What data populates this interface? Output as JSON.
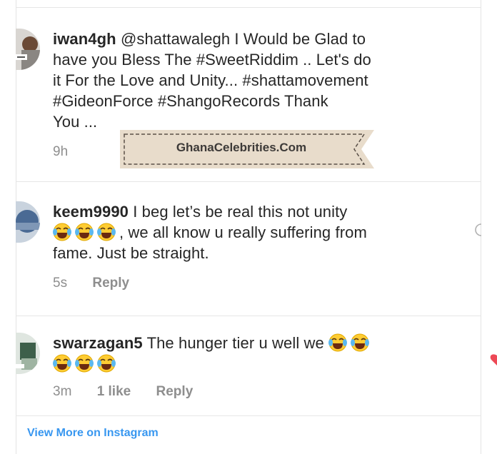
{
  "comments": [
    {
      "username": "iwan4gh",
      "lines": [
        "@shattawalegh I Would be Glad to",
        "have you Bless The #SweetRiddim .. Let's do",
        "it For the Love and Unity... #shattamovement",
        "#GideonForce #ShangoRecords Thank",
        "You ..."
      ],
      "time": "9h"
    },
    {
      "username": "keem9990",
      "line1": "I beg let’s be real this not unity",
      "line2": ",  we all know u really suffering from",
      "line3": "fame. Just be straight.",
      "time": "5s",
      "reply": "Reply"
    },
    {
      "username": "swarzagan5",
      "line1": "The hunger tier u well we",
      "time": "3m",
      "likes": "1 like",
      "reply": "Reply"
    }
  ],
  "watermark": "GhanaCelebrities.Com",
  "view_more": "View More on Instagram",
  "colors": {
    "text": "#262626",
    "muted": "#8e8e8e",
    "link": "#3897f0",
    "watermark_bg": "#e8dccb",
    "like_heart": "#ed4956"
  },
  "icons": [
    "laughing-tears-emoji",
    "heart-icon",
    "chat-icon"
  ]
}
